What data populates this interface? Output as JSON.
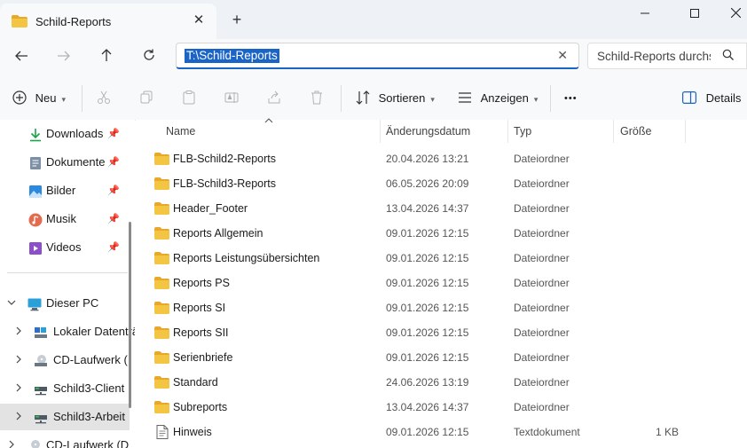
{
  "window": {
    "tab_title": "Schild-Reports",
    "new_tab_symbol": "+",
    "close_tab_symbol": "✕"
  },
  "address": {
    "path": "T:\\Schild-Reports",
    "search_placeholder": "Schild-Reports durchsuchen"
  },
  "toolbar": {
    "new_label": "Neu",
    "sort_label": "Sortieren",
    "view_label": "Anzeigen",
    "more_label": "•••",
    "details_label": "Details"
  },
  "sidebar": {
    "quick_access": [
      {
        "label": "Downloads",
        "icon": "download-icon"
      },
      {
        "label": "Dokumente",
        "icon": "documents-icon"
      },
      {
        "label": "Bilder",
        "icon": "pictures-icon"
      },
      {
        "label": "Musik",
        "icon": "music-icon"
      },
      {
        "label": "Videos",
        "icon": "videos-icon"
      }
    ],
    "this_pc": "Dieser PC",
    "drives": [
      {
        "label": "Lokaler Datenträger",
        "icon": "local-disk-icon"
      },
      {
        "label": "CD-Laufwerk (",
        "icon": "cd-drive-icon"
      },
      {
        "label": "Schild3-Client",
        "icon": "network-drive-icon"
      },
      {
        "label": "Schild3-Arbeit",
        "icon": "network-drive-icon"
      },
      {
        "label": "CD-Laufwerk (D",
        "icon": "cd-drive-icon"
      }
    ]
  },
  "columns": {
    "name": "Name",
    "date": "Änderungsdatum",
    "type": "Typ",
    "size": "Größe"
  },
  "files": [
    {
      "name": "FLB-Schild2-Reports",
      "date": "20.04.2026 13:21",
      "type": "Dateiordner",
      "size": ""
    },
    {
      "name": "FLB-Schild3-Reports",
      "date": "06.05.2026 20:09",
      "type": "Dateiordner",
      "size": ""
    },
    {
      "name": "Header_Footer",
      "date": "13.04.2026 14:37",
      "type": "Dateiordner",
      "size": ""
    },
    {
      "name": "Reports Allgemein",
      "date": "09.01.2026 12:15",
      "type": "Dateiordner",
      "size": ""
    },
    {
      "name": "Reports Leistungsübersichten",
      "date": "09.01.2026 12:15",
      "type": "Dateiordner",
      "size": ""
    },
    {
      "name": "Reports PS",
      "date": "09.01.2026 12:15",
      "type": "Dateiordner",
      "size": ""
    },
    {
      "name": "Reports SI",
      "date": "09.01.2026 12:15",
      "type": "Dateiordner",
      "size": ""
    },
    {
      "name": "Reports SII",
      "date": "09.01.2026 12:15",
      "type": "Dateiordner",
      "size": ""
    },
    {
      "name": "Serienbriefe",
      "date": "09.01.2026 12:15",
      "type": "Dateiordner",
      "size": ""
    },
    {
      "name": "Standard",
      "date": "24.06.2026 13:19",
      "type": "Dateiordner",
      "size": ""
    },
    {
      "name": "Subreports",
      "date": "13.04.2026 14:37",
      "type": "Dateiordner",
      "size": ""
    },
    {
      "name": "Hinweis",
      "date": "09.01.2026 12:15",
      "type": "Textdokument",
      "size": "1 KB"
    }
  ],
  "colors": {
    "folder": "#f4c542",
    "accent": "#1a63c7",
    "selection": "#e3e3e3"
  }
}
